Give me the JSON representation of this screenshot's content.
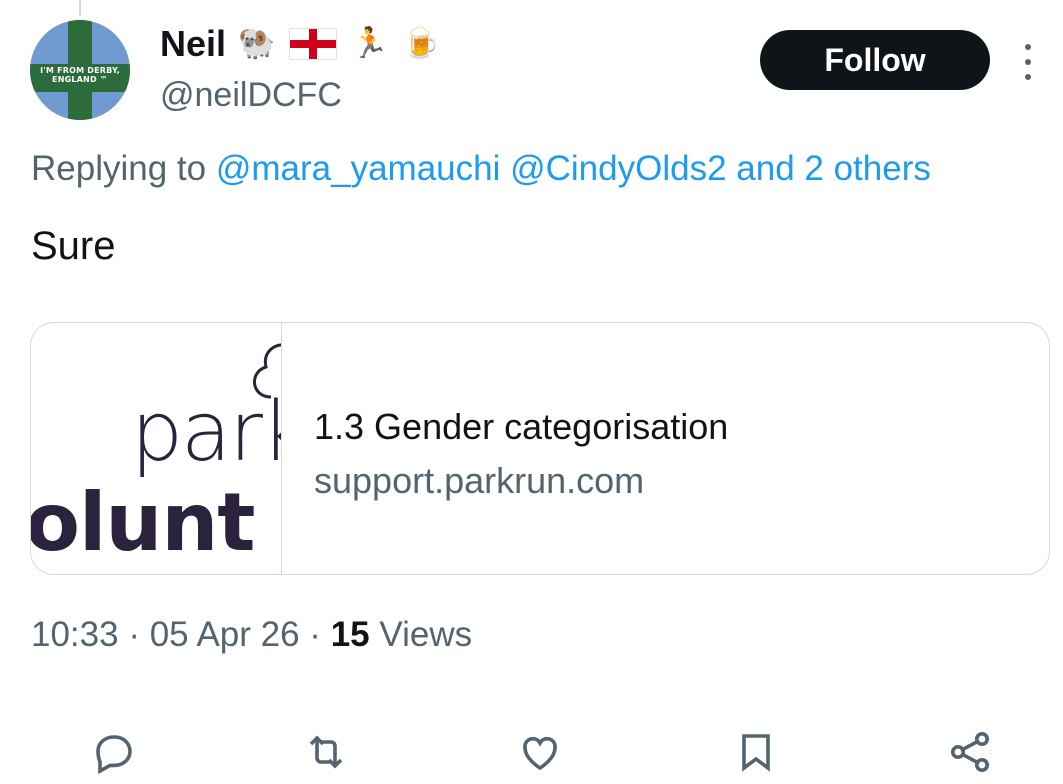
{
  "author": {
    "name": "Neil",
    "emojis": [
      "ram-emoji",
      "england-flag",
      "runner-emoji",
      "beer-emoji"
    ],
    "handle": "@neilDCFC",
    "avatar_text": "I'M FROM DERBY, ENGLAND ™"
  },
  "follow_label": "Follow",
  "reply": {
    "prefix": "Replying to",
    "mentions": "@mara_yamauchi @CindyOlds2 and 2 others"
  },
  "tweet_text": "Sure",
  "card": {
    "thumb_word_top": "park",
    "thumb_word_bottom": "olunt",
    "title": "1.3 Gender categorisation",
    "domain": "support.parkrun.com"
  },
  "meta": {
    "time": "10:33",
    "date": "05 Apr 26",
    "views_count": "15",
    "views_label": "Views"
  },
  "colors": {
    "text": "#0f1419",
    "secondary": "#536471",
    "link": "#1d9bf0",
    "button": "#0f1419"
  },
  "actions": [
    "reply-icon",
    "retweet-icon",
    "like-icon",
    "bookmark-icon",
    "share-icon"
  ]
}
